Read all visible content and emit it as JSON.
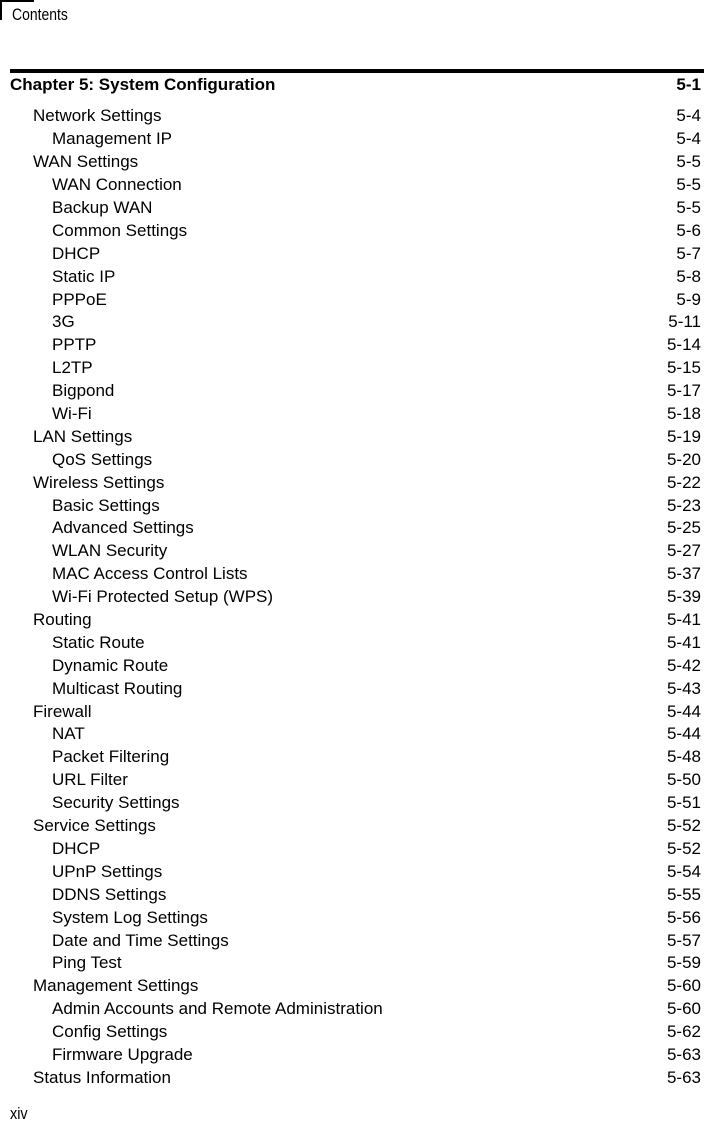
{
  "header": {
    "label": "Contents"
  },
  "chapter": {
    "title": "Chapter 5: System Configuration",
    "page": "5-1"
  },
  "entries": [
    {
      "label": "Network Settings",
      "page": "5-4",
      "level": 1
    },
    {
      "label": "Management IP",
      "page": "5-4",
      "level": 2
    },
    {
      "label": "WAN Settings",
      "page": "5-5",
      "level": 1
    },
    {
      "label": "WAN Connection",
      "page": "5-5",
      "level": 2
    },
    {
      "label": "Backup WAN",
      "page": "5-5",
      "level": 2
    },
    {
      "label": "Common Settings",
      "page": "5-6",
      "level": 2
    },
    {
      "label": "DHCP",
      "page": "5-7",
      "level": 2
    },
    {
      "label": "Static IP",
      "page": "5-8",
      "level": 2
    },
    {
      "label": "PPPoE",
      "page": "5-9",
      "level": 2
    },
    {
      "label": "3G",
      "page": "5-11",
      "level": 2
    },
    {
      "label": "PPTP",
      "page": "5-14",
      "level": 2
    },
    {
      "label": "L2TP",
      "page": "5-15",
      "level": 2
    },
    {
      "label": "Bigpond",
      "page": "5-17",
      "level": 2
    },
    {
      "label": "Wi-Fi",
      "page": "5-18",
      "level": 2
    },
    {
      "label": "LAN Settings",
      "page": "5-19",
      "level": 1
    },
    {
      "label": "QoS Settings",
      "page": "5-20",
      "level": 2
    },
    {
      "label": "Wireless Settings",
      "page": "5-22",
      "level": 1
    },
    {
      "label": "Basic Settings",
      "page": "5-23",
      "level": 2
    },
    {
      "label": "Advanced Settings",
      "page": "5-25",
      "level": 2
    },
    {
      "label": "WLAN Security",
      "page": "5-27",
      "level": 2
    },
    {
      "label": "MAC Access Control Lists",
      "page": "5-37",
      "level": 2
    },
    {
      "label": "Wi-Fi Protected Setup (WPS)",
      "page": "5-39",
      "level": 2
    },
    {
      "label": "Routing",
      "page": "5-41",
      "level": 1
    },
    {
      "label": "Static Route",
      "page": "5-41",
      "level": 2
    },
    {
      "label": "Dynamic Route",
      "page": "5-42",
      "level": 2
    },
    {
      "label": "Multicast Routing",
      "page": "5-43",
      "level": 2
    },
    {
      "label": "Firewall",
      "page": "5-44",
      "level": 1
    },
    {
      "label": "NAT",
      "page": "5-44",
      "level": 2
    },
    {
      "label": "Packet Filtering",
      "page": "5-48",
      "level": 2
    },
    {
      "label": "URL Filter",
      "page": "5-50",
      "level": 2
    },
    {
      "label": "Security Settings",
      "page": "5-51",
      "level": 2
    },
    {
      "label": "Service Settings",
      "page": "5-52",
      "level": 1
    },
    {
      "label": "DHCP",
      "page": "5-52",
      "level": 2
    },
    {
      "label": "UPnP Settings",
      "page": "5-54",
      "level": 2
    },
    {
      "label": "DDNS Settings",
      "page": "5-55",
      "level": 2
    },
    {
      "label": "System Log Settings",
      "page": "5-56",
      "level": 2
    },
    {
      "label": "Date and Time Settings",
      "page": "5-57",
      "level": 2
    },
    {
      "label": "Ping Test",
      "page": "5-59",
      "level": 2
    },
    {
      "label": "Management Settings",
      "page": "5-60",
      "level": 1
    },
    {
      "label": "Admin Accounts and Remote Administration",
      "page": "5-60",
      "level": 2
    },
    {
      "label": "Config Settings",
      "page": "5-62",
      "level": 2
    },
    {
      "label": "Firmware Upgrade",
      "page": "5-63",
      "level": 2
    },
    {
      "label": "Status Information",
      "page": "5-63",
      "level": 1
    }
  ],
  "footer": {
    "page_number": "xiv"
  }
}
